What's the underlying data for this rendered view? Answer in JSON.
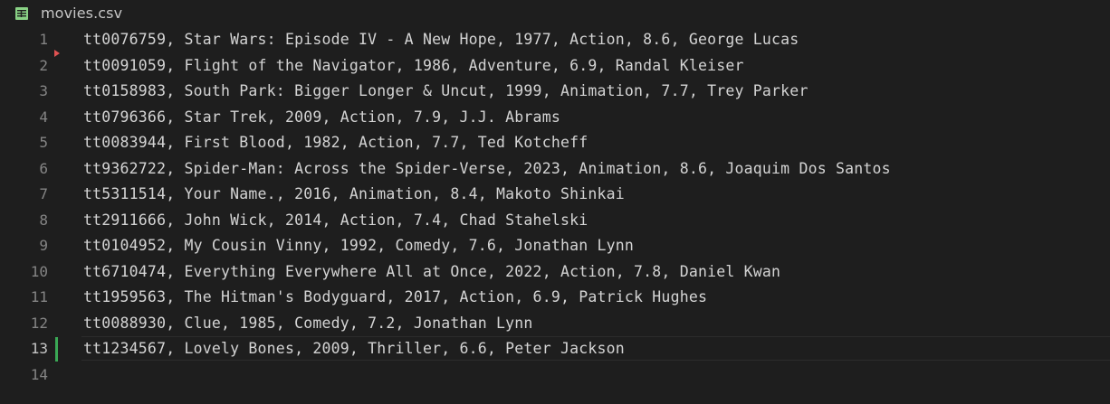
{
  "tab": {
    "filename": "movies.csv",
    "icon": "csv-file-icon",
    "icon_color": "#89d185"
  },
  "editor": {
    "lines": [
      {
        "number": "1",
        "text": "tt0076759, Star Wars: Episode IV - A New Hope, 1977, Action, 8.6, George Lucas"
      },
      {
        "number": "2",
        "text": "tt0091059, Flight of the Navigator, 1986, Adventure, 6.9, Randal Kleiser"
      },
      {
        "number": "3",
        "text": "tt0158983, South Park: Bigger Longer & Uncut, 1999, Animation, 7.7, Trey Parker"
      },
      {
        "number": "4",
        "text": "tt0796366, Star Trek, 2009, Action, 7.9, J.J. Abrams"
      },
      {
        "number": "5",
        "text": "tt0083944, First Blood, 1982, Action, 7.7, Ted Kotcheff"
      },
      {
        "number": "6",
        "text": "tt9362722, Spider-Man: Across the Spider-Verse, 2023, Animation, 8.6, Joaquim Dos Santos"
      },
      {
        "number": "7",
        "text": "tt5311514, Your Name., 2016, Animation, 8.4, Makoto Shinkai"
      },
      {
        "number": "8",
        "text": "tt2911666, John Wick, 2014, Action, 7.4, Chad Stahelski"
      },
      {
        "number": "9",
        "text": "tt0104952, My Cousin Vinny, 1992, Comedy, 7.6, Jonathan Lynn"
      },
      {
        "number": "10",
        "text": "tt6710474, Everything Everywhere All at Once, 2022, Action, 7.8, Daniel Kwan"
      },
      {
        "number": "11",
        "text": "tt1959563, The Hitman's Bodyguard, 2017, Action, 6.9, Patrick Hughes"
      },
      {
        "number": "12",
        "text": "tt0088930, Clue, 1985, Comedy, 7.2, Jonathan Lynn"
      },
      {
        "number": "13",
        "text": "tt1234567, Lovely Bones, 2009, Thriller, 6.6, Peter Jackson"
      },
      {
        "number": "14",
        "text": ""
      }
    ],
    "active_line": "13"
  },
  "colors": {
    "background": "#1e1e1e",
    "text": "#d4d4d4",
    "line_number": "#858585",
    "git_added": "#3aa855",
    "git_deleted": "#e05252"
  }
}
